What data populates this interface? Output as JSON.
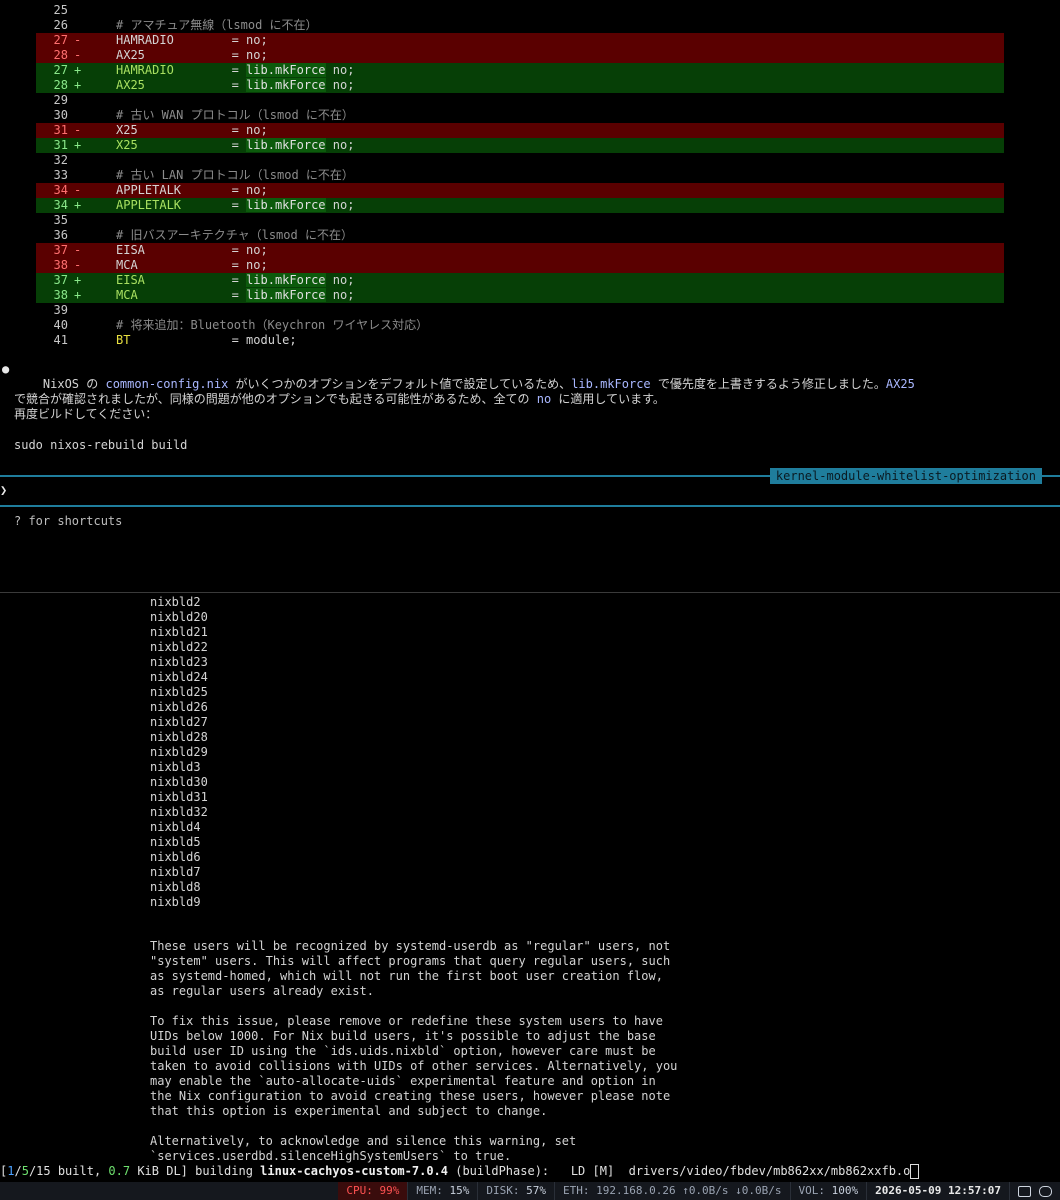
{
  "diff": [
    {
      "n": "25",
      "t": "ctx",
      "c": ""
    },
    {
      "n": "26",
      "t": "ctx",
      "c": "# アマチュア無線（lsmod に不在）",
      "cmt": true
    },
    {
      "n": "27",
      "t": "del",
      "c": "HAMRADIO        = no;"
    },
    {
      "n": "28",
      "t": "del",
      "c": "AX25            = no;"
    },
    {
      "n": "27",
      "t": "add",
      "key": "HAMRADIO",
      "pad": "        = ",
      "val": "lib.mkForce",
      "tail": " no;"
    },
    {
      "n": "28",
      "t": "add",
      "key": "AX25",
      "pad": "            = ",
      "val": "lib.mkForce",
      "tail": " no;"
    },
    {
      "n": "29",
      "t": "ctx",
      "c": ""
    },
    {
      "n": "30",
      "t": "ctx",
      "c": "# 古い WAN プロトコル（lsmod に不在）",
      "cmt": true
    },
    {
      "n": "31",
      "t": "del",
      "c": "X25             = no;"
    },
    {
      "n": "31",
      "t": "add",
      "key": "X25",
      "pad": "             = ",
      "val": "lib.mkForce",
      "tail": " no;"
    },
    {
      "n": "32",
      "t": "ctx",
      "c": ""
    },
    {
      "n": "33",
      "t": "ctx",
      "c": "# 古い LAN プロトコル（lsmod に不在）",
      "cmt": true
    },
    {
      "n": "34",
      "t": "del",
      "c": "APPLETALK       = no;"
    },
    {
      "n": "34",
      "t": "add",
      "key": "APPLETALK",
      "pad": "       = ",
      "val": "lib.mkForce",
      "tail": " no;"
    },
    {
      "n": "35",
      "t": "ctx",
      "c": ""
    },
    {
      "n": "36",
      "t": "ctx",
      "c": "# 旧バスアーキテクチャ（lsmod に不在）",
      "cmt": true
    },
    {
      "n": "37",
      "t": "del",
      "c": "EISA            = no;"
    },
    {
      "n": "38",
      "t": "del",
      "c": "MCA             = no;"
    },
    {
      "n": "37",
      "t": "add",
      "key": "EISA",
      "pad": "            = ",
      "val": "lib.mkForce",
      "tail": " no;"
    },
    {
      "n": "38",
      "t": "add",
      "key": "MCA",
      "pad": "             = ",
      "val": "lib.mkForce",
      "tail": " no;"
    },
    {
      "n": "39",
      "t": "ctx",
      "c": ""
    },
    {
      "n": "40",
      "t": "ctx",
      "c": "# 将来追加：Bluetooth（Keychron ワイヤレス対応）",
      "cmt": true
    },
    {
      "n": "41",
      "t": "ctxkw",
      "key": "BT",
      "rest": "              = module;"
    }
  ],
  "markers": {
    "del": "-",
    "add": "+"
  },
  "assistant": {
    "bullet": "●",
    "l1a": "NixOS の ",
    "l1b": "common-config.nix",
    "l1c": " がいくつかのオプションをデフォルト値で設定しているため、",
    "l1d": "lib.mkForce",
    "l1e": " で優先度を上書きするよう修正しました。",
    "l1f": "AX25",
    "l2a": "で競合が確認されましたが、同様の問題が他のオプションでも起きる可能性があるため、全ての ",
    "l2b": "no",
    "l2c": " に適用しています。",
    "l3": "再度ビルドしてください：",
    "l4": "sudo nixos-rebuild build"
  },
  "branch": "kernel-module-whitelist-optimization",
  "prompt": "❯",
  "hint": "? for shortcuts",
  "users": [
    "nixbld2",
    "nixbld20",
    "nixbld21",
    "nixbld22",
    "nixbld23",
    "nixbld24",
    "nixbld25",
    "nixbld26",
    "nixbld27",
    "nixbld28",
    "nixbld29",
    "nixbld3",
    "nixbld30",
    "nixbld31",
    "nixbld32",
    "nixbld4",
    "nixbld5",
    "nixbld6",
    "nixbld7",
    "nixbld8",
    "nixbld9"
  ],
  "warning": [
    "These users will be recognized by systemd-userdb as \"regular\" users, not",
    "\"system\" users. This will affect programs that query regular users, such",
    "as systemd-homed, which will not run the first boot user creation flow,",
    "as regular users already exist.",
    "",
    "To fix this issue, please remove or redefine these system users to have",
    "UIDs below 1000. For Nix build users, it's possible to adjust the base",
    "build user ID using the `ids.uids.nixbld` option, however care must be",
    "taken to avoid collisions with UIDs of other services. Alternatively, you",
    "may enable the `auto-allocate-uids` experimental feature and option in",
    "the Nix configuration to avoid creating these users, however please note",
    "that this option is experimental and subject to change.",
    "",
    "Alternatively, to acknowledge and silence this warning, set",
    "`services.userdbd.silenceHighSystemUsers` to true."
  ],
  "build": {
    "b1": "[",
    "done": "1",
    "sep": "/",
    "running": "5",
    "b2": "/15 built, ",
    "dl": "0.7",
    "b3": " KiB DL] building ",
    "pkg": "linux-cachyos-custom-7.0.4",
    "b4": " (buildPhase):   LD [M]  drivers/video/fbdev/mb862xx/mb862xxfb.o"
  },
  "status": {
    "cpu_label": "CPU:",
    "cpu": "99%",
    "mem_label": "MEM:",
    "mem": "15%",
    "disk_label": "DISK:",
    "disk": "57%",
    "eth": "ETH: 192.168.0.26 ↑0.0B/s ↓0.0B/s",
    "vol_label": "VOL:",
    "vol": "100%",
    "time": "2026-05-09 12:57:07"
  },
  "colors": {
    "del_bg": "#5a0000",
    "add_bg": "#063f06",
    "accent": "#1f7d9c"
  }
}
